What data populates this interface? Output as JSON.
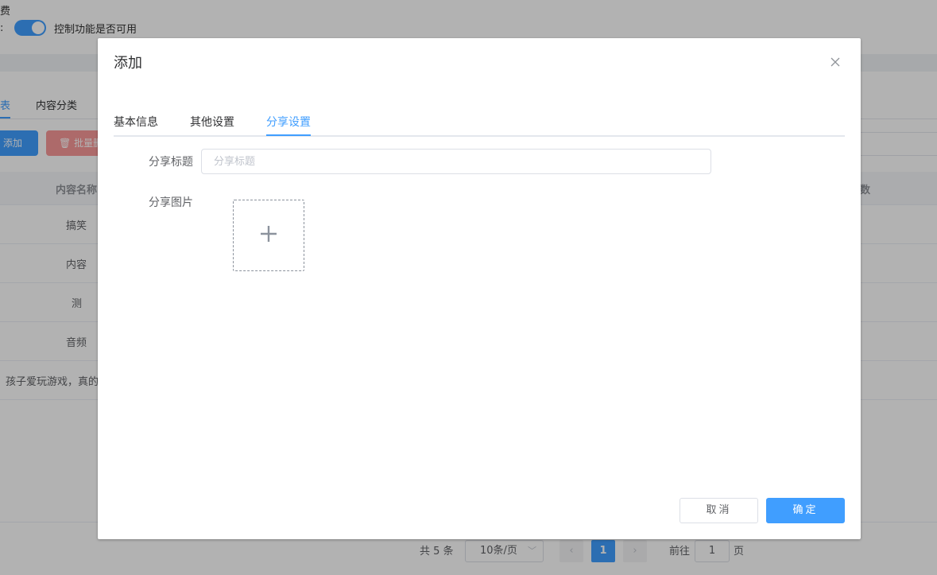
{
  "background": {
    "top_label": "费",
    "switch_colon": ":",
    "switch_text": "控制功能是否可用",
    "tabs": [
      {
        "label": "表"
      },
      {
        "label": "内容分类"
      }
    ],
    "add_button": "添加",
    "batch_button": "批量删",
    "table": {
      "headers": [
        "内容名称",
        "数"
      ],
      "rows": [
        "搞笑",
        "内容",
        "测",
        "音频",
        "孩子爱玩游戏，真的"
      ]
    },
    "pagination": {
      "total": "共 5 条",
      "page_size": "10条/页",
      "current_page": "1",
      "goto_prefix": "前往",
      "goto_value": "1",
      "goto_suffix": "页"
    }
  },
  "dialog": {
    "title": "添加",
    "tabs": [
      {
        "label": "基本信息"
      },
      {
        "label": "其他设置"
      },
      {
        "label": "分享设置",
        "active": true
      }
    ],
    "form": {
      "share_title_label": "分享标题",
      "share_title_placeholder": "分享标题",
      "share_title_value": "",
      "share_image_label": "分享图片"
    },
    "buttons": {
      "cancel": "取消",
      "confirm": "确定"
    }
  },
  "colors": {
    "primary": "#409eff",
    "danger_light": "#f89898",
    "overlay": "rgba(0,0,0,0.3)"
  }
}
